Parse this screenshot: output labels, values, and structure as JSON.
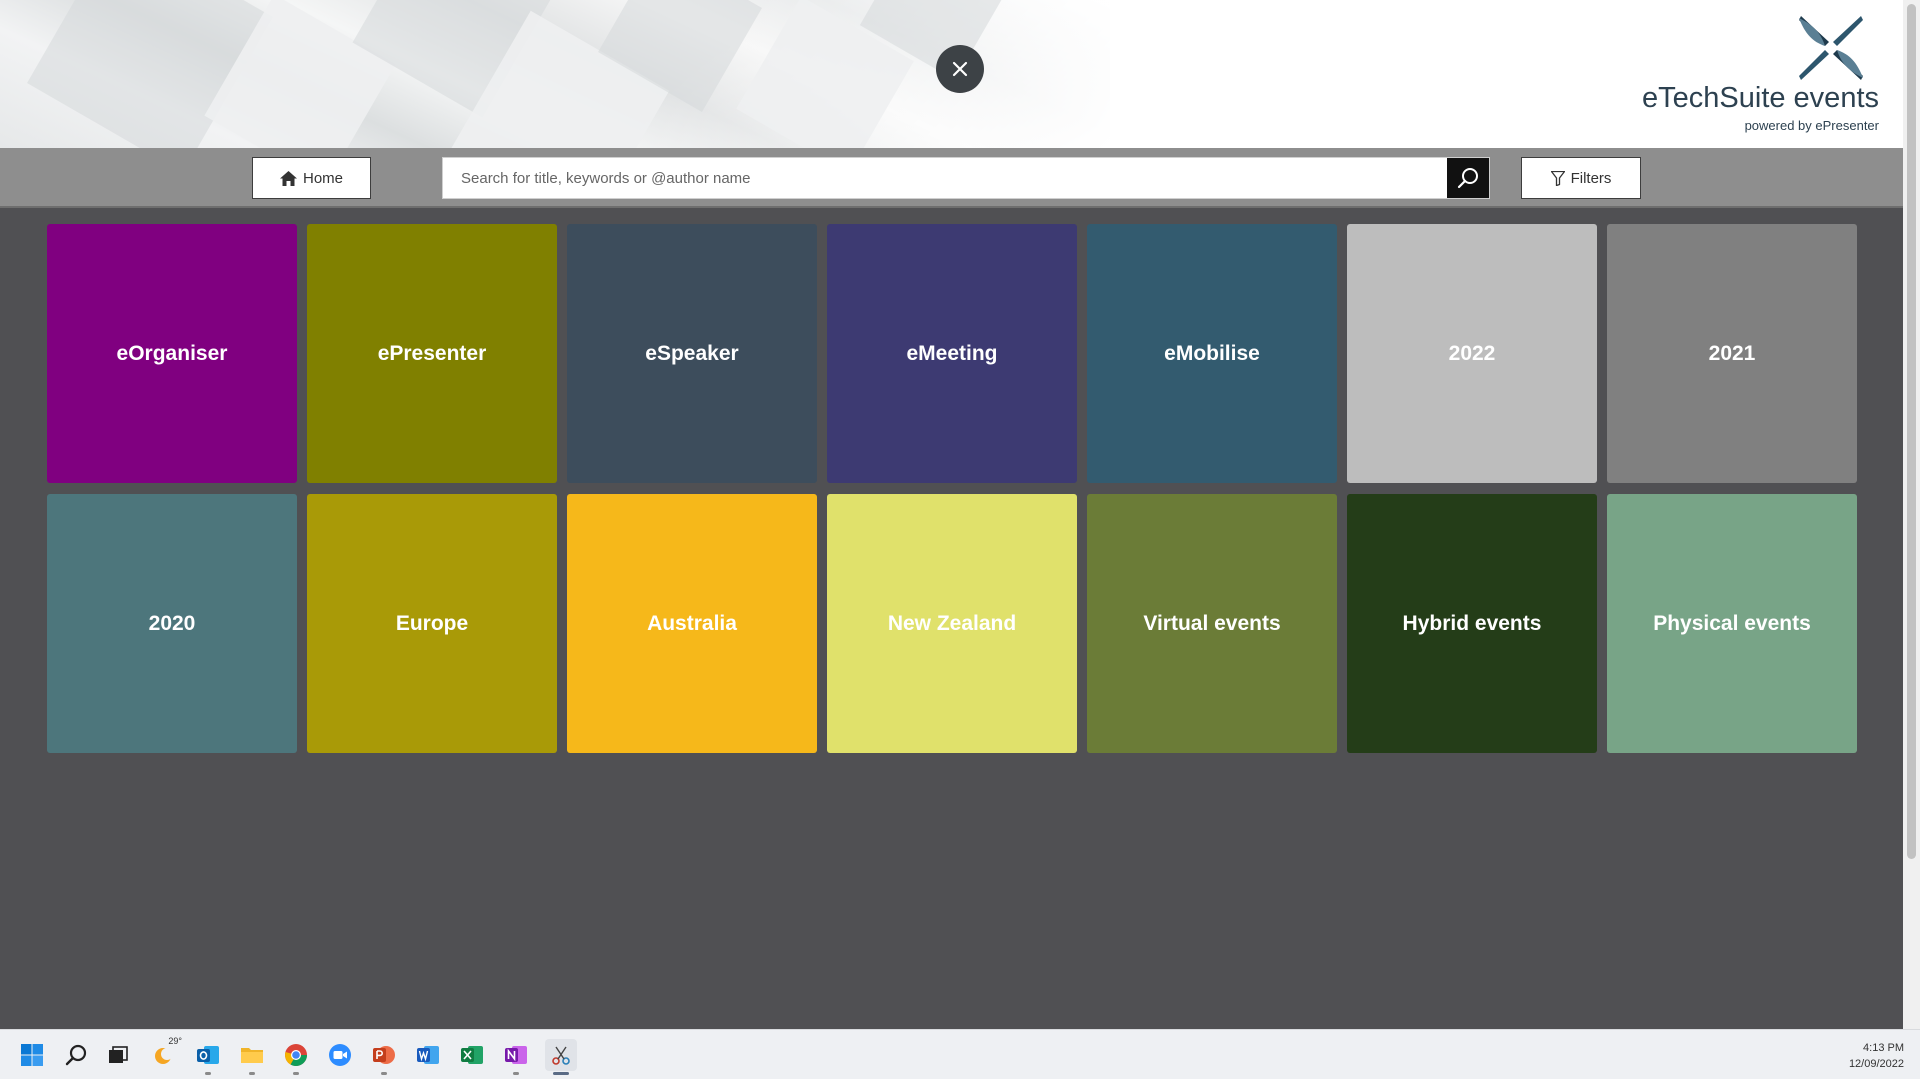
{
  "header": {
    "close_label": "×",
    "logo_title": "eTechSuite events",
    "logo_subtitle": "powered by ePresenter"
  },
  "toolbar": {
    "home_label": "Home",
    "search_placeholder": "Search for title, keywords or @author name",
    "filters_label": "Filters"
  },
  "tiles": [
    {
      "label": "eOrganiser",
      "color": "#800080",
      "text_color": "#ffffff"
    },
    {
      "label": "ePresenter",
      "color": "#808000",
      "text_color": "#ffffff"
    },
    {
      "label": "eSpeaker",
      "color": "#3d4d5c",
      "text_color": "#ffffff"
    },
    {
      "label": "eMeeting",
      "color": "#3d3a72",
      "text_color": "#ffffff"
    },
    {
      "label": "eMobilise",
      "color": "#335b6f",
      "text_color": "#ffffff"
    },
    {
      "label": "2022",
      "color": "#bdbdbd",
      "text_color": "#ffffff"
    },
    {
      "label": "2021",
      "color": "#808080",
      "text_color": "#ffffff"
    },
    {
      "label": "2020",
      "color": "#4d767c",
      "text_color": "#ffffff"
    },
    {
      "label": "Europe",
      "color": "#a99a07",
      "text_color": "#ffffff"
    },
    {
      "label": "Australia",
      "color": "#f6b81a",
      "text_color": "#ffffff"
    },
    {
      "label": "New Zealand",
      "color": "#e0e16b",
      "text_color": "#ffffff"
    },
    {
      "label": "Virtual events",
      "color": "#6b7c37",
      "text_color": "#ffffff"
    },
    {
      "label": "Hybrid events",
      "color": "#243d18",
      "text_color": "#ffffff"
    },
    {
      "label": "Physical events",
      "color": "#78a487",
      "text_color": "#ffffff"
    }
  ],
  "taskbar": {
    "weather_temp": "29°",
    "icons": [
      "windows-start-icon",
      "search-icon",
      "task-view-icon",
      "weather-icon",
      "outlook-icon",
      "file-explorer-icon",
      "chrome-icon",
      "zoom-icon",
      "powerpoint-icon",
      "word-icon",
      "excel-icon",
      "onenote-icon",
      "snipping-tool-icon"
    ],
    "time": "4:13 PM",
    "date": "12/09/2022"
  }
}
